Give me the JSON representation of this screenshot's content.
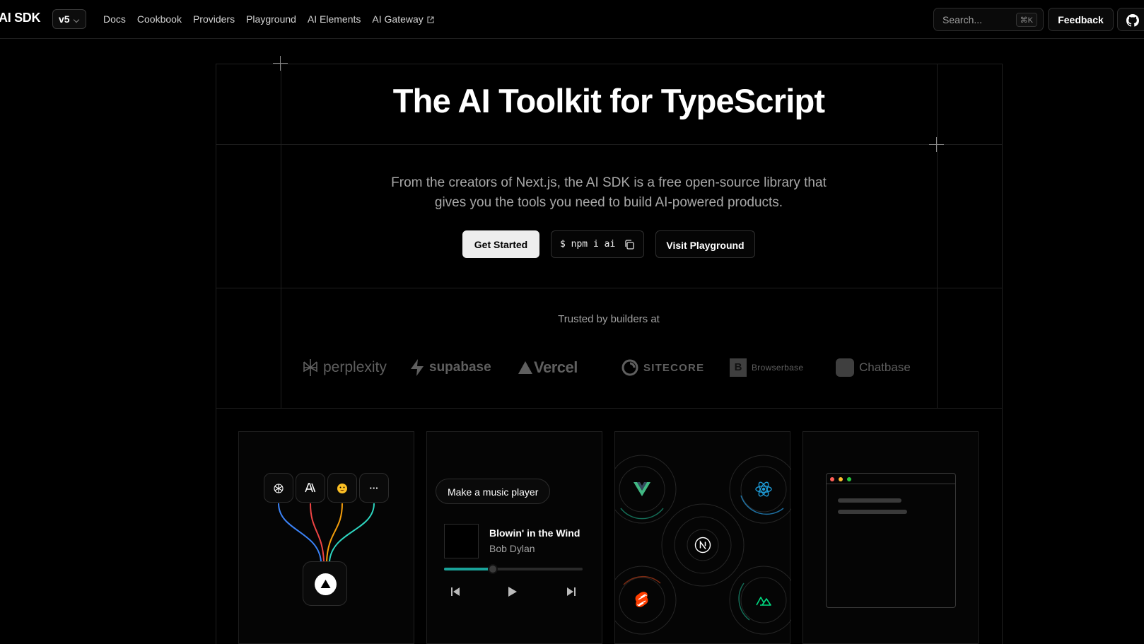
{
  "nav": {
    "logo": "AI SDK",
    "version": "v5",
    "links": [
      "Docs",
      "Cookbook",
      "Providers",
      "Playground",
      "AI Elements",
      "AI Gateway"
    ],
    "search_placeholder": "Search...",
    "search_shortcut": "⌘K",
    "feedback_label": "Feedback"
  },
  "hero": {
    "title": "The AI Toolkit for TypeScript",
    "description_line1": "From the creators of Next.js, the AI SDK is a free open-source library that",
    "description_line2": "gives you the tools you need to build AI-powered products.",
    "primary_cta": "Get Started",
    "install_command": "$ npm i ai",
    "secondary_cta": "Visit Playground"
  },
  "trusted": {
    "label": "Trusted by builders at",
    "brands": [
      "perplexity",
      "supabase",
      "Vercel",
      "SITECORE",
      "Browserbase",
      "Chatbase"
    ]
  },
  "cards": {
    "providers": {
      "more_label": "···"
    },
    "music": {
      "prompt": "Make a music player",
      "song_title": "Blowin' in the Wind",
      "artist": "Bob Dylan",
      "progress": 0.35
    },
    "frameworks": {
      "items": [
        "vue-icon",
        "react-icon",
        "nextjs-icon",
        "svelte-icon",
        "nuxt-icon"
      ]
    }
  },
  "colors": {
    "background": "#000000",
    "border": "#1e1e1e",
    "accent_teal": "#1aa39a",
    "react_blue": "#1e9bd7",
    "vue_green": "#41b883",
    "svelte_orange": "#ff3e00"
  }
}
